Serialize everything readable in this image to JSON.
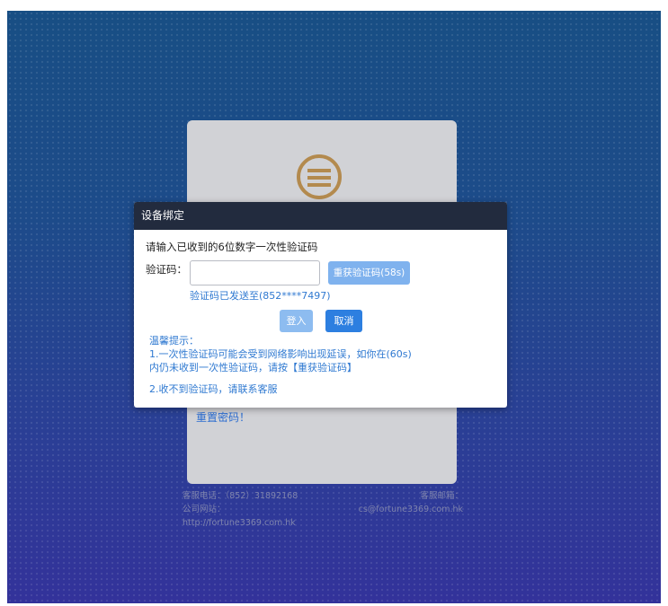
{
  "login_card": {
    "reset_password_link": "重置密码！"
  },
  "footer": {
    "phone_label": "客服电话：（852）31892168",
    "website_label": "公司网站：",
    "website_url": "http://fortune3369.com.hk",
    "email_label": "客服邮箱：",
    "email": "cs@fortune3369.com.hk"
  },
  "dialog": {
    "title": "设备绑定",
    "prompt": "请输入已收到的6位数字一次性验证码",
    "code_label": "验证码：",
    "code_value": "",
    "resend_button": "重获验证码(58s)",
    "sent_info": "验证码已发送至(852****7497)",
    "login_button": "登入",
    "cancel_button": "取消",
    "tips_title": "温馨提示：",
    "tip1_line1": "1.一次性验证码可能会受到网络影响出现延误，如你在(60s)",
    "tip1_line2": "内仍未收到一次性验证码，请按【重获验证码】",
    "tip2": "2.收不到验证码，请联系客服"
  }
}
